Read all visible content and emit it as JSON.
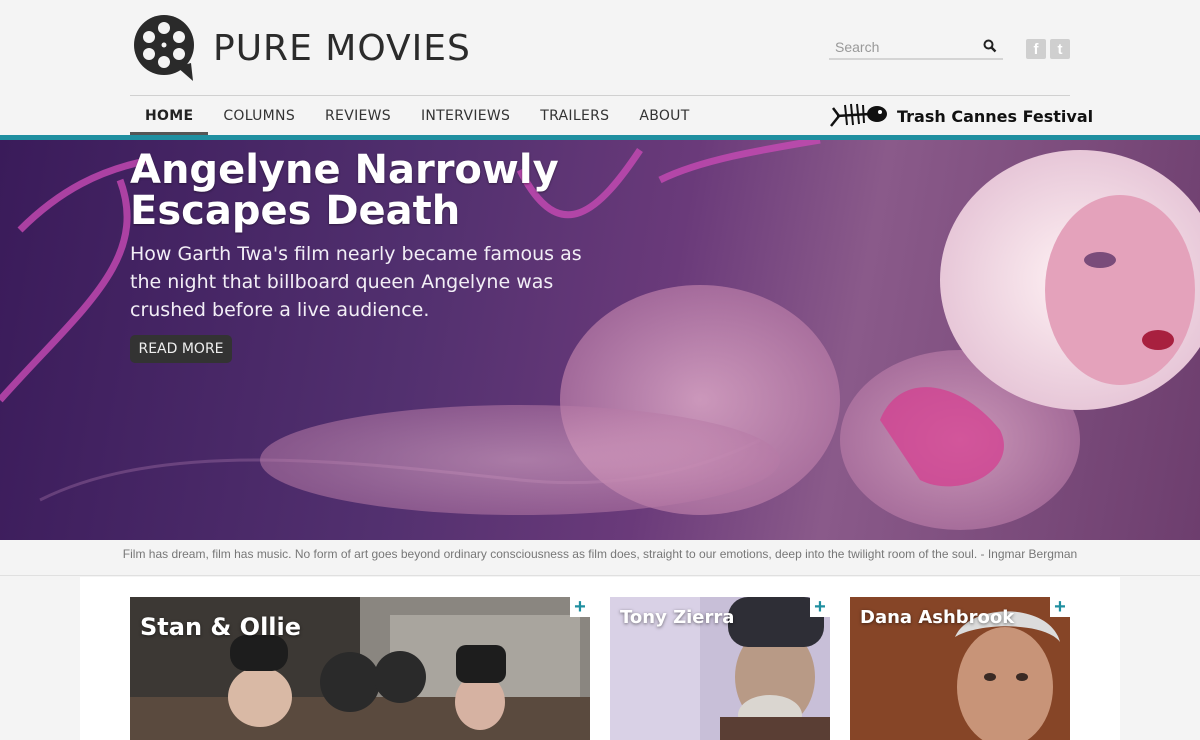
{
  "site": {
    "name": "PURE MOVIES"
  },
  "search": {
    "placeholder": "Search"
  },
  "social": [
    {
      "icon": "facebook-icon",
      "glyph": "f"
    },
    {
      "icon": "twitter-icon",
      "glyph": "t"
    }
  ],
  "nav": {
    "items": [
      "HOME",
      "COLUMNS",
      "REVIEWS",
      "INTERVIEWS",
      "TRAILERS",
      "ABOUT"
    ],
    "active": "HOME"
  },
  "festival": {
    "label": "Trash Cannes Festival",
    "icon": "fish-skeleton-icon"
  },
  "hero": {
    "title": "Angelyne Narrowly Escapes Death",
    "subtitle": "How Garth Twa's film nearly became famous as the night that billboard queen Angelyne was crushed before a live audience.",
    "cta": "READ MORE"
  },
  "quote": "Film has dream, film has music. No form of art goes beyond ordinary consciousness as film does, straight to our emotions, deep into the twilight room of the soul. - Ingmar Bergman",
  "cards": [
    {
      "title": "Stan & Ollie",
      "plus": "+"
    },
    {
      "title": "Tony Zierra",
      "plus": "+"
    },
    {
      "title": "Dana Ashbrook",
      "plus": "+"
    }
  ],
  "colors": {
    "accent": "#1f8fa0",
    "nav_active": "#555555",
    "button": "#333333"
  }
}
